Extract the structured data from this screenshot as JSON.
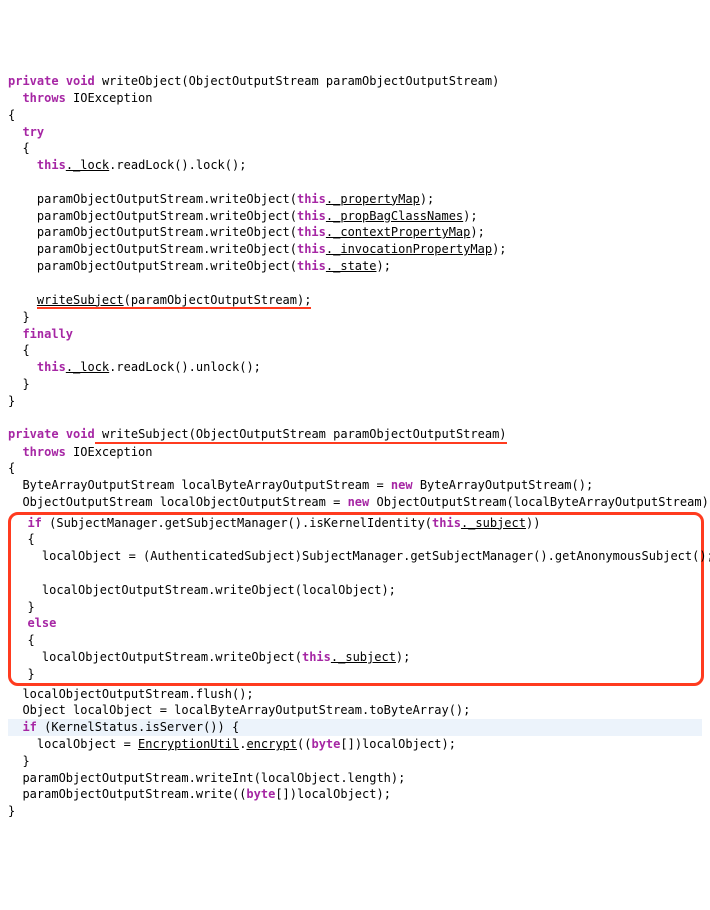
{
  "code": {
    "l1_a": "private",
    "l1_b": "void",
    "l1_c": " writeObject(ObjectOutputStream paramObjectOutputStream)",
    "l2_a": "throws",
    "l2_b": " IOException",
    "l3": "{",
    "l4": "try",
    "l5": "  {",
    "l6_a": "this",
    "l6_b": "._lock",
    "l6_c": ".readLock().lock();",
    "blank": "",
    "l8_a": "    paramObjectOutputStream.writeObject(",
    "l8_b": "this",
    "l8_c": "._propertyMap",
    "l8_d": ");",
    "l9_a": "    paramObjectOutputStream.writeObject(",
    "l9_b": "this",
    "l9_c": "._propBagClassNames",
    "l9_d": ");",
    "l10_a": "    paramObjectOutputStream.writeObject(",
    "l10_b": "this",
    "l10_c": "._contextPropertyMap",
    "l10_d": ");",
    "l11_a": "    paramObjectOutputStream.writeObject(",
    "l11_b": "this",
    "l11_c": "._invocationPropertyMap",
    "l11_d": ");",
    "l12_a": "    paramObjectOutputStream.writeObject(",
    "l12_b": "this",
    "l12_c": "._state",
    "l12_d": ");",
    "l14_pad": "    ",
    "l14_a": "writeSubject",
    "l14_b": "(paramObjectOutputStream);",
    "l15": "  }",
    "l16": "finally",
    "l17": "  {",
    "l18_a": "this",
    "l18_b": "._lock",
    "l18_c": ".readLock().unlock();",
    "l19": "  }",
    "l20": "}",
    "m1_a": "private",
    "m1_b": "void",
    "m1_c": " writeSubject(ObjectOutputStream paramObjectOutputStream)",
    "m2_a": "throws",
    "m2_b": " IOException",
    "m3": "{",
    "m4_a": "  ByteArrayOutputStream localByteArrayOutputStream = ",
    "m4_b": "new",
    "m4_c": " ByteArrayOutputStream();",
    "m5_a": "  ObjectOutputStream localObjectOutputStream = ",
    "m5_b": "new",
    "m5_c": " ObjectOutputStream(localByteArrayOutputStream);",
    "box1_a": "if",
    "box1_b": " (SubjectManager.getSubjectManager().isKernelIdentity(",
    "box1_c": "this",
    "box1_d": "._subject",
    "box1_e": "))",
    "box2": "  {",
    "box3": "    localObject = (AuthenticatedSubject)SubjectManager.getSubjectManager().getAnonymousSubject();",
    "box5": "    localObjectOutputStream.writeObject(localObject);",
    "box6": "  }",
    "box7": "else",
    "box8": "  {",
    "box9_a": "    localObjectOutputStream.writeObject(",
    "box9_b": "this",
    "box9_c": "._subject",
    "box9_d": ");",
    "box10": "  }",
    "a1": "  localObjectOutputStream.flush();",
    "a2": "  Object localObject = localByteArrayOutputStream.toByteArray();",
    "a3_a": "if",
    "a3_b": " (KernelStatus.isServer()) {",
    "a4_a": "    localObject = ",
    "a4_b": "EncryptionUtil",
    "a4_c": ".",
    "a4_d": "encrypt",
    "a4_e": "((",
    "a4_f": "byte",
    "a4_g": "[])localObject);",
    "a5": "  }",
    "a6": "  paramObjectOutputStream.writeInt(localObject.length);",
    "a7_a": "  paramObjectOutputStream.write((",
    "a7_b": "byte",
    "a7_c": "[])localObject);",
    "a8": "}"
  }
}
